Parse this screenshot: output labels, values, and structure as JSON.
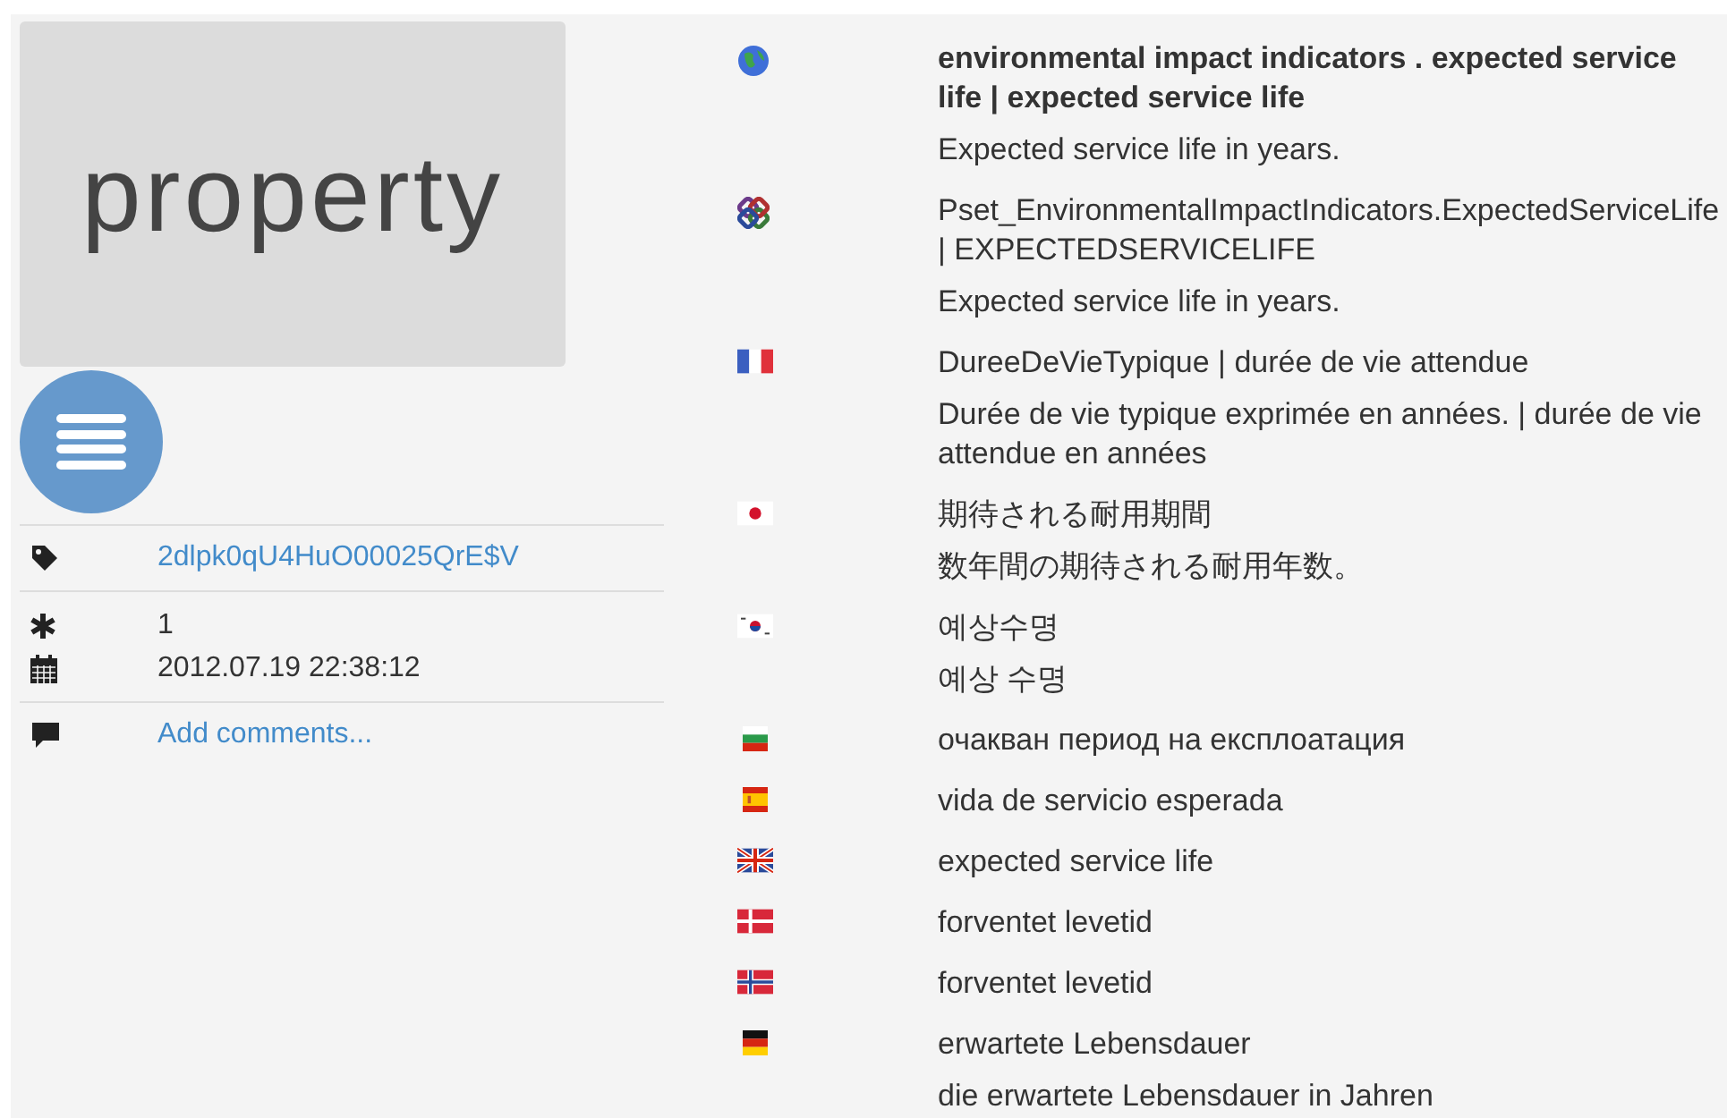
{
  "thumbnail": {
    "label": "property"
  },
  "details": {
    "guid": "2dlpk0qU4HuO00025QrE$V",
    "version": "1",
    "date": "2012.07.19 22:38:12",
    "comment_link": "Add comments..."
  },
  "entries": [
    {
      "kind": "international",
      "name": "environmental impact indicators . expected service life | expected service life",
      "description": "Expected service life in years."
    },
    {
      "kind": "ifc",
      "name": "Pset_EnvironmentalImpactIndicators.ExpectedServiceLife | EXPECTEDSERVICELIFE",
      "description": "Expected service life in years."
    },
    {
      "kind": "fr",
      "name": "DureeDeVieTypique | durée de vie attendue",
      "description": "Durée de vie typique exprimée en années. | durée de vie attendue en années"
    },
    {
      "kind": "ja",
      "name": "期待される耐用期間",
      "description": "数年間の期待される耐用年数。"
    },
    {
      "kind": "ko",
      "name": "예상수명",
      "description": "예상 수명"
    },
    {
      "kind": "bg",
      "name": "очакван период на експлоатация"
    },
    {
      "kind": "es",
      "name": "vida de servicio esperada"
    },
    {
      "kind": "gb",
      "name": "expected service life"
    },
    {
      "kind": "dk",
      "name": "forventet levetid"
    },
    {
      "kind": "no",
      "name": "forventet levetid"
    },
    {
      "kind": "de",
      "name": "erwartete Lebensdauer",
      "description": "die erwartete Lebensdauer in Jahren"
    }
  ]
}
